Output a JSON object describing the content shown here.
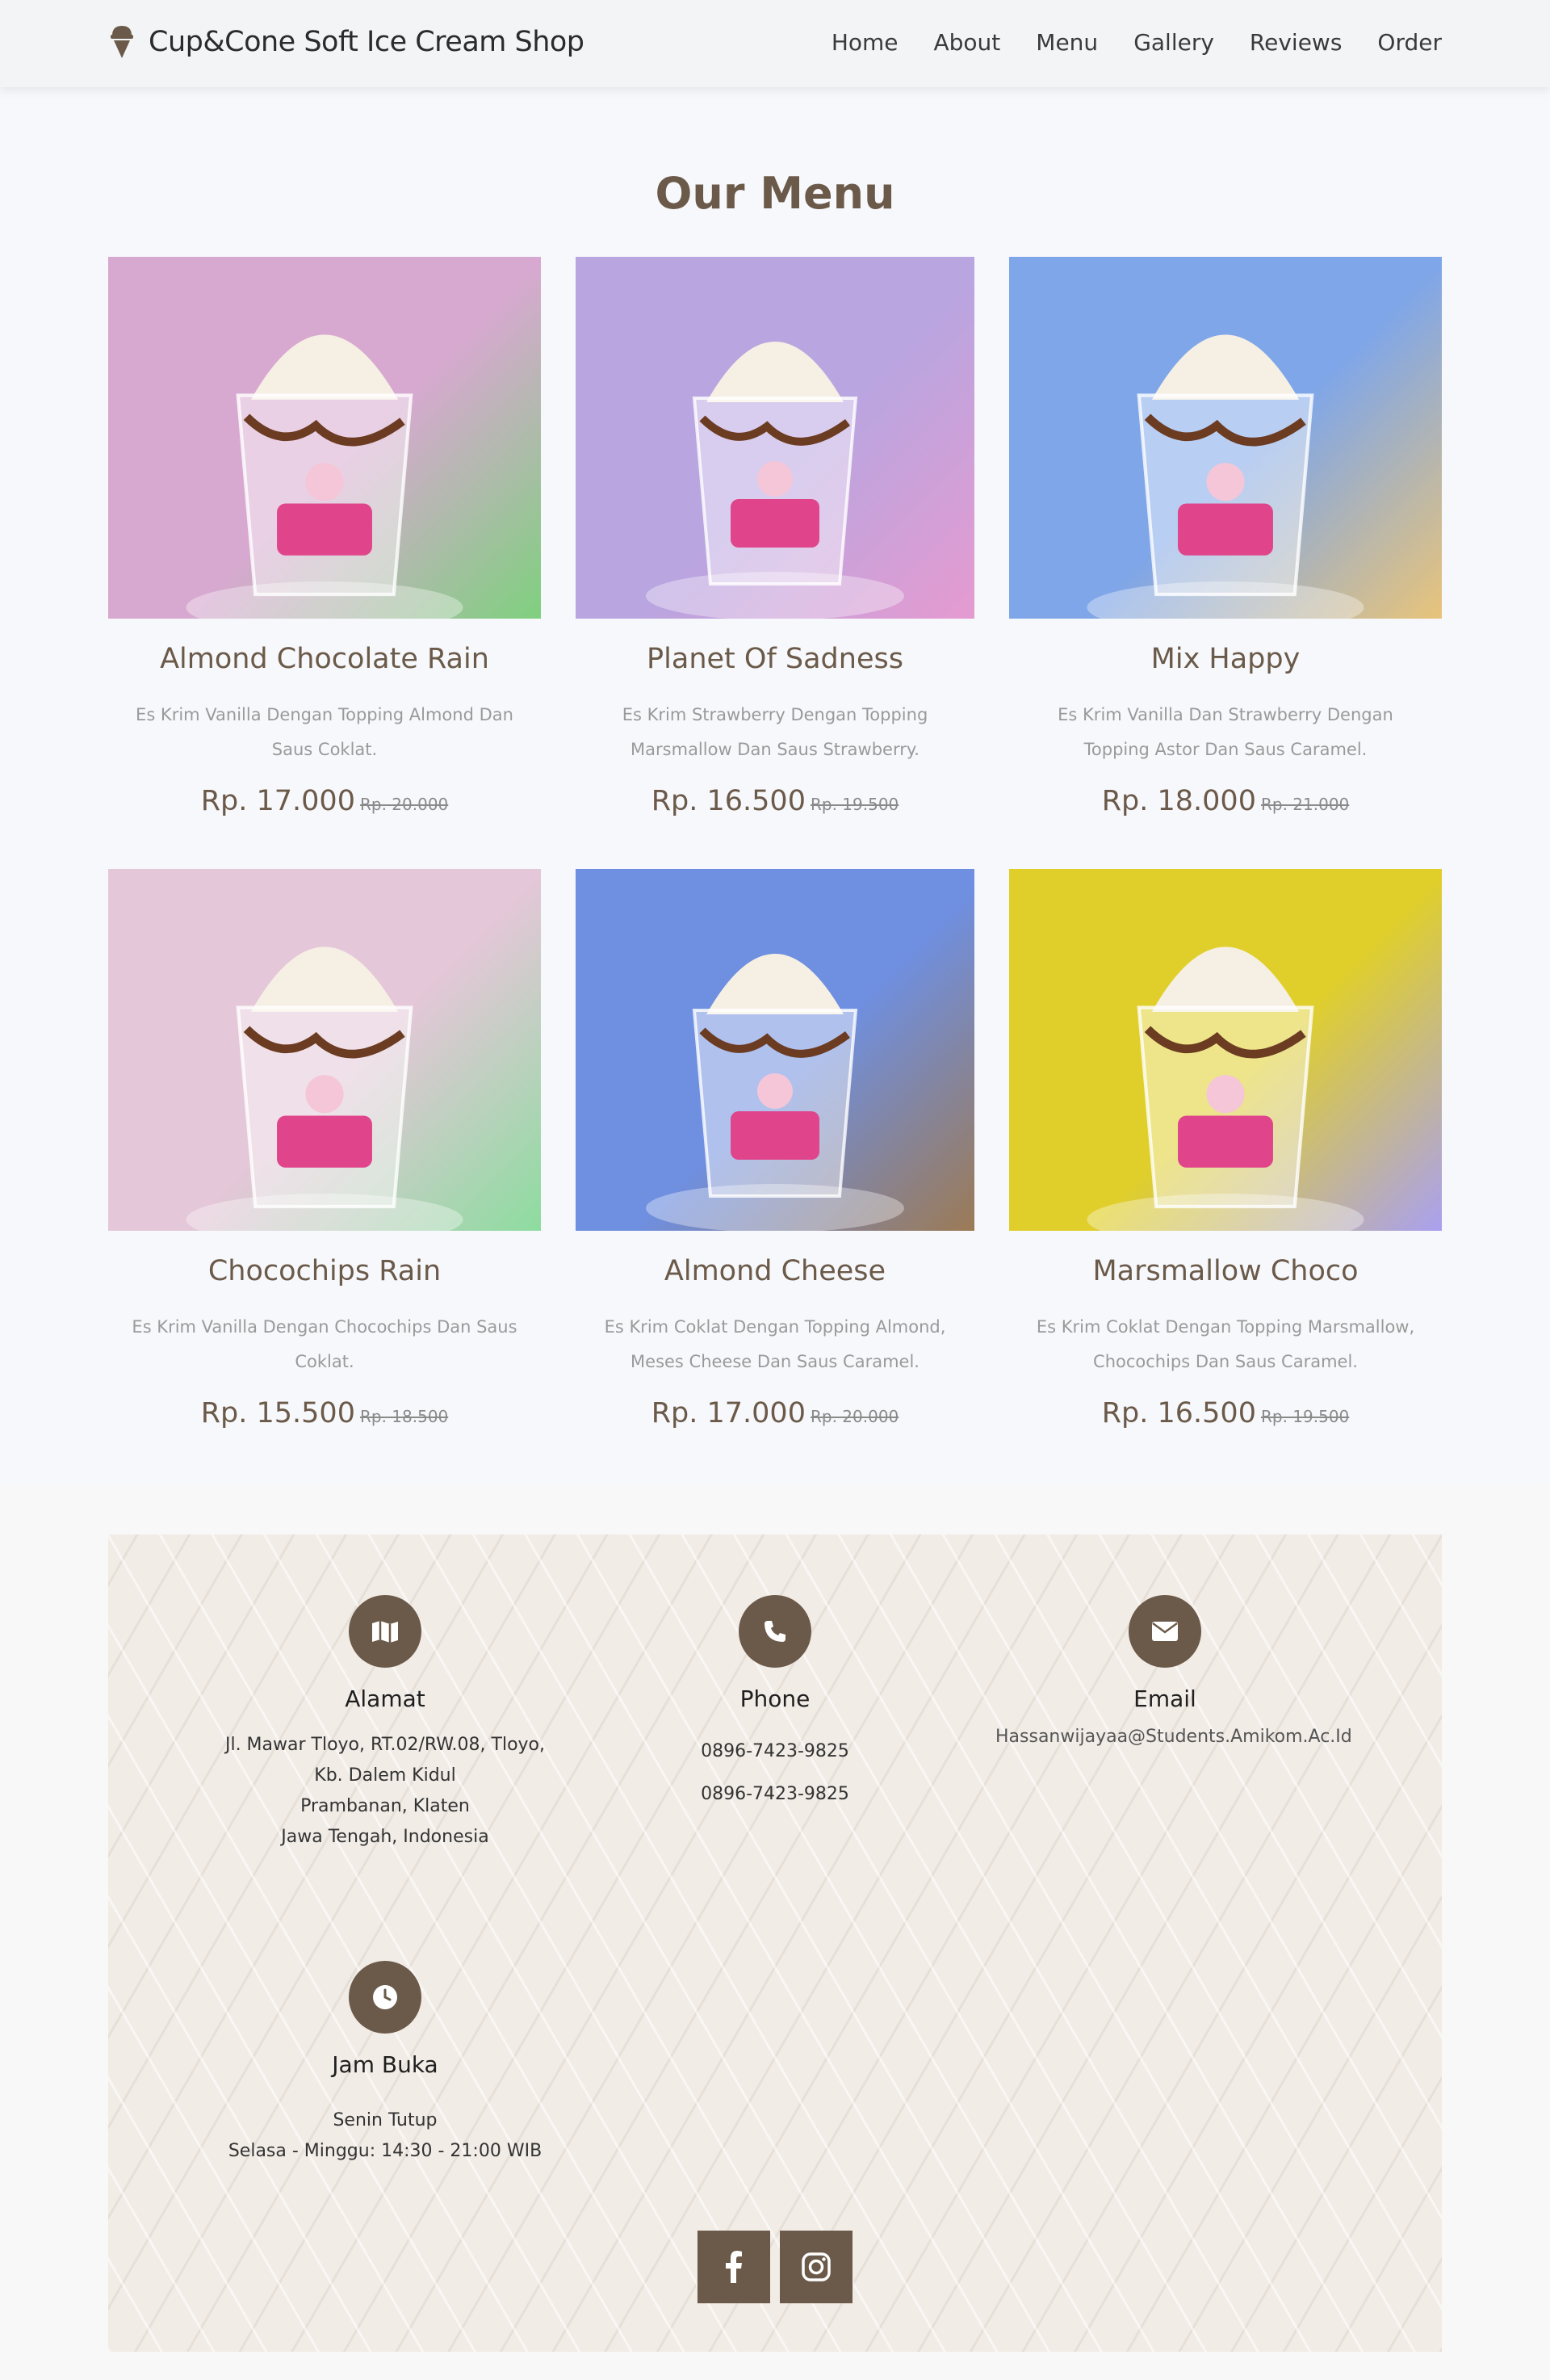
{
  "navbar": {
    "brand": "Cup&Cone Soft Ice Cream Shop",
    "links": [
      "Home",
      "About",
      "Menu",
      "Gallery",
      "Reviews",
      "Order"
    ]
  },
  "menu": {
    "title": "Our Menu",
    "items": [
      {
        "name": "Almond Chocolate Rain",
        "desc": "Es Krim Vanilla Dengan Topping Almond Dan Saus Coklat.",
        "price": "Rp. 17.000",
        "old_price": "Rp. 20.000",
        "colors": [
          "#d7a9d0",
          "#7fd07f"
        ]
      },
      {
        "name": "Planet Of Sadness",
        "desc": "Es Krim Strawberry Dengan Topping Marsmallow Dan Saus Strawberry.",
        "price": "Rp. 16.500",
        "old_price": "Rp. 19.500",
        "colors": [
          "#b9a5e0",
          "#e59bd0"
        ]
      },
      {
        "name": "Mix Happy",
        "desc": "Es Krim Vanilla Dan Strawberry Dengan Topping Astor Dan Saus Caramel.",
        "price": "Rp. 18.000",
        "old_price": "Rp. 21.000",
        "colors": [
          "#7fa6e8",
          "#e8c47a"
        ]
      },
      {
        "name": "Chocochips Rain",
        "desc": "Es Krim Vanilla Dengan Chocochips Dan Saus Coklat.",
        "price": "Rp. 15.500",
        "old_price": "Rp. 18.500",
        "colors": [
          "#e4c7d8",
          "#8ddc9f"
        ]
      },
      {
        "name": "Almond Cheese",
        "desc": "Es Krim Coklat Dengan Topping Almond, Meses Cheese Dan Saus Caramel.",
        "price": "Rp. 17.000",
        "old_price": "Rp. 20.000",
        "colors": [
          "#6f8fe0",
          "#9c7a55"
        ]
      },
      {
        "name": "Marsmallow Choco",
        "desc": "Es Krim Coklat Dengan Topping Marsmallow, Chocochips Dan Saus Caramel.",
        "price": "Rp. 16.500",
        "old_price": "Rp. 19.500",
        "colors": [
          "#e0cf2a",
          "#a9a0f0"
        ]
      }
    ]
  },
  "contact": {
    "alamat": {
      "title": "Alamat",
      "lines": [
        "Jl. Mawar Tloyo, RT.02/RW.08, Tloyo, Kb. Dalem Kidul",
        "Prambanan, Klaten",
        "Jawa Tengah, Indonesia"
      ]
    },
    "phone": {
      "title": "Phone",
      "lines": [
        "0896-7423-9825",
        "0896-7423-9825"
      ]
    },
    "email": {
      "title": "Email",
      "value": "Hassanwijayaa@Students.Amikom.Ac.Id"
    },
    "jam": {
      "title": "Jam Buka",
      "lines": [
        "Senin Tutup",
        "Selasa - Minggu: 14:30 - 21:00 WIB"
      ]
    }
  },
  "social": [
    "facebook-icon",
    "instagram-icon"
  ],
  "theme": {
    "accent": "#6b5a49",
    "background": "#f7f8fc"
  }
}
